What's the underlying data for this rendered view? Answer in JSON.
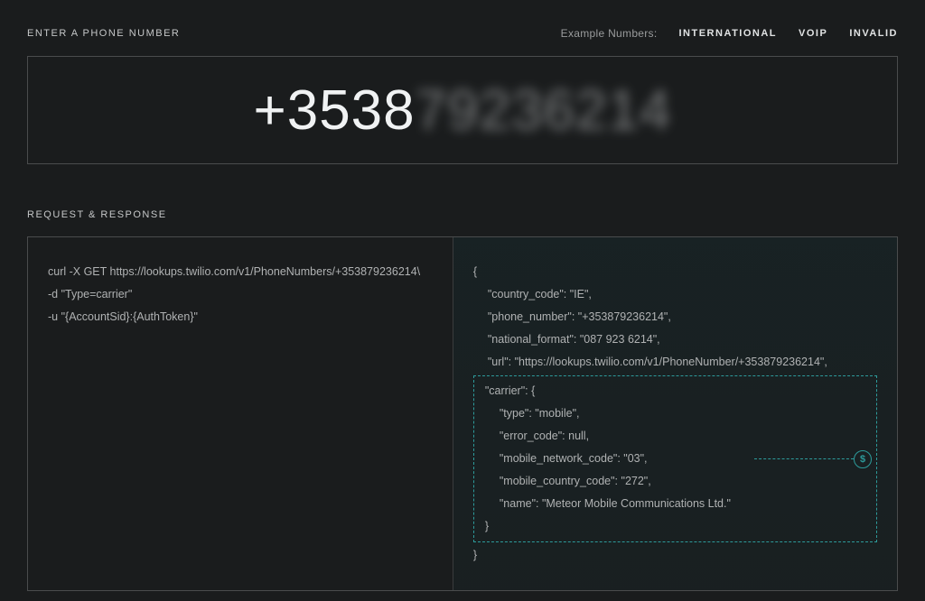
{
  "top": {
    "section_label": "ENTER A PHONE NUMBER",
    "example_label": "Example Numbers:",
    "examples": {
      "intl": "INTERNATIONAL",
      "voip": "VOIP",
      "invalid": "INVALID"
    },
    "phone_crisp": "+3538",
    "phone_blur": "79236214"
  },
  "rr": {
    "section_label": "REQUEST & RESPONSE",
    "request": {
      "line1": "curl -X GET https://lookups.twilio.com/v1/PhoneNumbers/+353879236214\\",
      "line2": "-d \"Type=carrier\"",
      "line3": "-u \"{AccountSid}:{AuthToken}\""
    },
    "response": {
      "open": "{",
      "country_code": "\"country_code\": \"IE\",",
      "phone_number": "\"phone_number\": \"+353879236214\",",
      "national_format": "\"national_format\": \"087 923 6214\",",
      "url": "\"url\": \"https://lookups.twilio.com/v1/PhoneNumber/+353879236214\",",
      "carrier_open": "\"carrier\": {",
      "type": "\"type\": \"mobile\",",
      "error_code": "\"error_code\": null,",
      "mnc": "\"mobile_network_code\": \"03\",",
      "mcc": "\"mobile_country_code\": \"272\",",
      "name": "\"name\": \"Meteor Mobile Communications Ltd.\"",
      "carrier_close": "}",
      "close": "}"
    },
    "dollar": "$"
  }
}
